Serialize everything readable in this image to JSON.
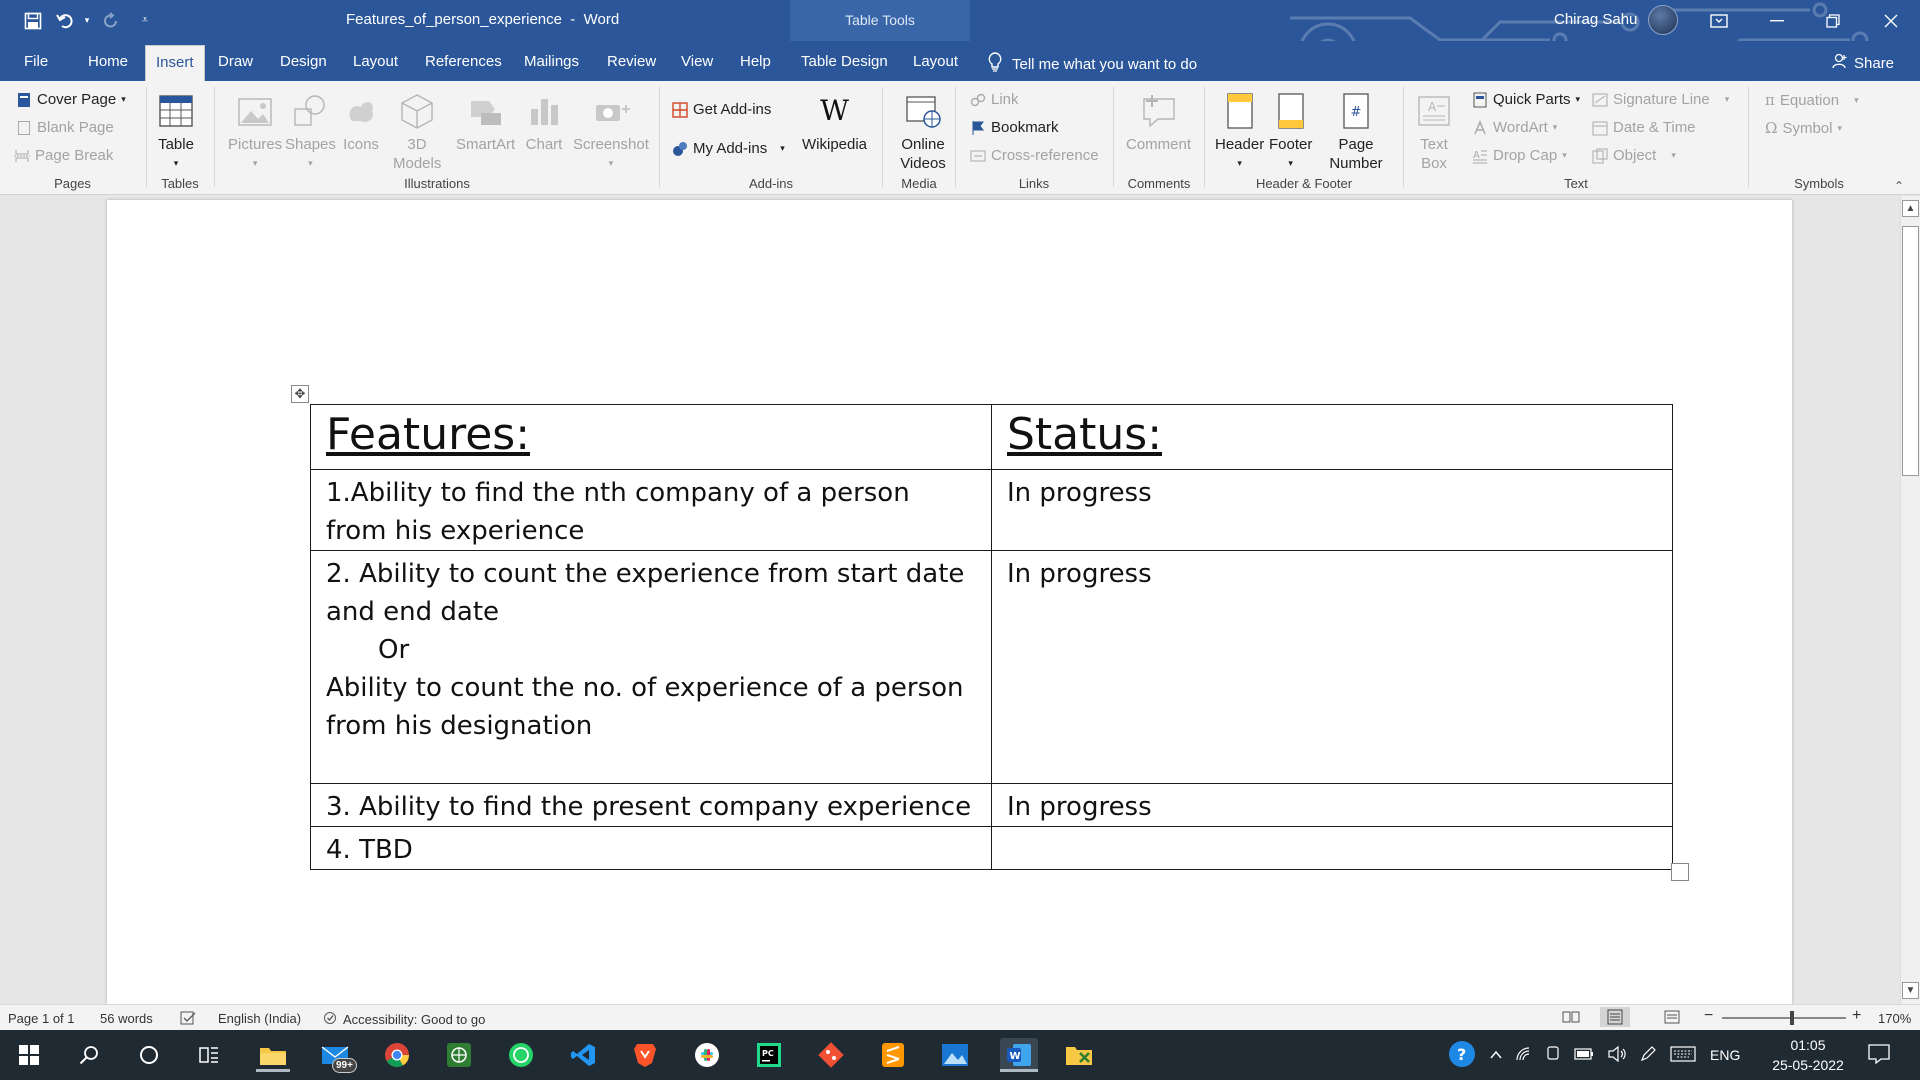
{
  "titlebar": {
    "document_title": "Features_of_person_experience  -  Word",
    "context_tab_group": "Table Tools",
    "user_name": "Chirag Sahu"
  },
  "tabs": [
    {
      "label": "File"
    },
    {
      "label": "Home"
    },
    {
      "label": "Insert"
    },
    {
      "label": "Draw"
    },
    {
      "label": "Design"
    },
    {
      "label": "Layout"
    },
    {
      "label": "References"
    },
    {
      "label": "Mailings"
    },
    {
      "label": "Review"
    },
    {
      "label": "View"
    },
    {
      "label": "Help"
    },
    {
      "label": "Table Design"
    },
    {
      "label": "Layout"
    }
  ],
  "tell_me": "Tell me what you want to do",
  "share": "Share",
  "ribbon": {
    "pages": {
      "label": "Pages",
      "cover_page": "Cover Page",
      "blank_page": "Blank Page",
      "page_break": "Page Break"
    },
    "tables": {
      "label": "Tables",
      "table": "Table"
    },
    "illustrations": {
      "label": "Illustrations",
      "pictures": "Pictures",
      "shapes": "Shapes",
      "icons": "Icons",
      "models": "3D Models",
      "smartart": "SmartArt",
      "chart": "Chart",
      "screenshot": "Screenshot"
    },
    "addins": {
      "label": "Add-ins",
      "get_addins": "Get Add-ins",
      "my_addins": "My Add-ins",
      "wikipedia": "Wikipedia"
    },
    "media": {
      "label": "Media",
      "online_videos": "Online Videos"
    },
    "links": {
      "label": "Links",
      "link": "Link",
      "bookmark": "Bookmark",
      "cross_reference": "Cross-reference"
    },
    "comments": {
      "label": "Comments",
      "comment": "Comment"
    },
    "header_footer": {
      "label": "Header & Footer",
      "header": "Header",
      "footer": "Footer",
      "page_number": "Page Number"
    },
    "text": {
      "label": "Text",
      "text_box": "Text Box",
      "quick_parts": "Quick Parts",
      "wordart": "WordArt",
      "drop_cap": "Drop Cap",
      "signature_line": "Signature Line",
      "date_time": "Date & Time",
      "object": "Object"
    },
    "symbols": {
      "label": "Symbols",
      "equation": "Equation",
      "symbol": "Symbol"
    }
  },
  "document": {
    "table": {
      "headers": [
        "Features:",
        "Status:"
      ],
      "rows": [
        {
          "feature": "1.Ability to find the nth company of a person from his experience",
          "status": "In progress"
        },
        {
          "feature_lines": [
            "2. Ability to count the experience from start date and end date",
            "Or",
            "Ability to count the no. of experience of a person from his designation"
          ],
          "status": "In progress"
        },
        {
          "feature": "3. Ability to find the present company experience",
          "status": "In progress"
        },
        {
          "feature": "4. TBD",
          "status": ""
        }
      ]
    }
  },
  "statusbar": {
    "page": "Page 1 of 1",
    "words": "56 words",
    "language": "English (India)",
    "accessibility": "Accessibility: Good to go",
    "zoom": "170%"
  },
  "taskbar": {
    "mail_badge": "99+",
    "language": "ENG",
    "time": "01:05",
    "date": "25-05-2022"
  }
}
